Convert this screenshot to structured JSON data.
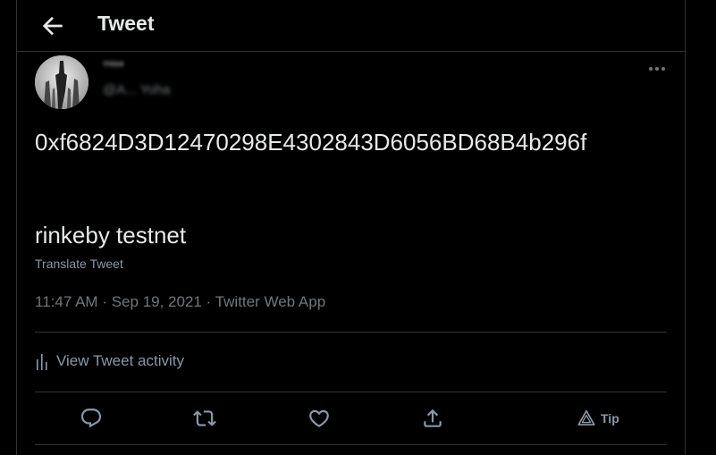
{
  "header": {
    "title": "Tweet",
    "back_icon": "arrow-left-icon"
  },
  "author": {
    "display_name": "ᐪᐡᐢᐤ",
    "handle": "@A... Yoha",
    "avatar_icon": "avatar-image"
  },
  "tweet": {
    "text_line1": "0xf6824D3D12470298E4302843D6056BD68B4b296f",
    "text_line2": "rinkeby testnet",
    "translate_label": "Translate Tweet",
    "time": "11:47 AM",
    "separator": "·",
    "date": "Sep 19, 2021",
    "source": "Twitter Web App"
  },
  "activity": {
    "label": "View Tweet activity",
    "icon": "bar-chart-icon"
  },
  "actions": {
    "reply_icon": "reply-icon",
    "retweet_icon": "retweet-icon",
    "like_icon": "heart-icon",
    "share_icon": "share-icon",
    "tip_icon": "tip-icon",
    "tip_label": "Tip"
  },
  "colors": {
    "background": "#000000",
    "text": "#e7e9ea",
    "muted": "#71767b",
    "border": "#2f3336"
  }
}
